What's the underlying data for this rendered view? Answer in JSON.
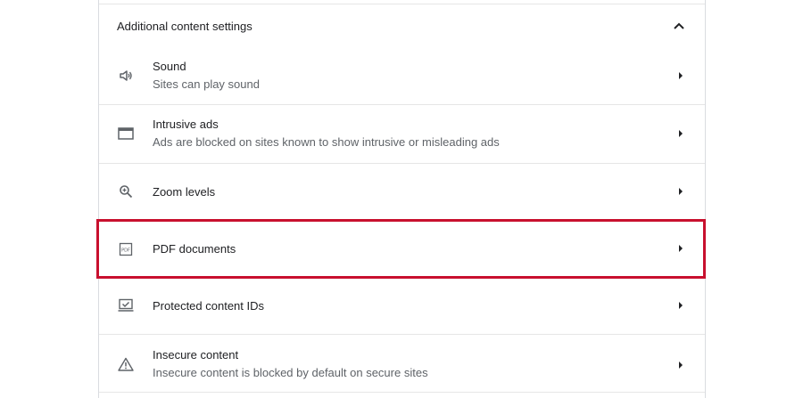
{
  "section": {
    "title": "Additional content settings",
    "collapse_icon": "chevron-up-icon"
  },
  "rows": [
    {
      "icon": "sound-icon",
      "title": "Sound",
      "subtitle": "Sites can play sound"
    },
    {
      "icon": "intrusive-ads-icon",
      "title": "Intrusive ads",
      "subtitle": "Ads are blocked on sites known to show intrusive or misleading ads"
    },
    {
      "icon": "zoom-icon",
      "title": "Zoom levels"
    },
    {
      "icon": "pdf-icon",
      "title": "PDF documents",
      "highlighted": true
    },
    {
      "icon": "protected-content-icon",
      "title": "Protected content IDs"
    },
    {
      "icon": "warning-icon",
      "title": "Insecure content",
      "subtitle": "Insecure content is blocked by default on secure sites"
    }
  ],
  "colors": {
    "highlight": "#c8102e",
    "text_primary": "#202124",
    "text_secondary": "#5f6368",
    "divider": "#e6e6e6"
  }
}
